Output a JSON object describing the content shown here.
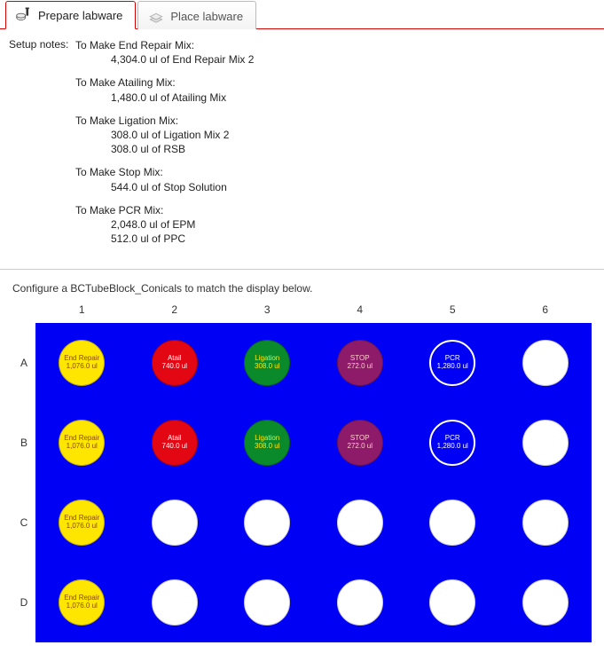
{
  "tabs": [
    {
      "label": "Prepare labware",
      "active": true
    },
    {
      "label": "Place labware",
      "active": false
    }
  ],
  "setup_label": "Setup notes:",
  "recipes": [
    {
      "title": "To Make End Repair Mix:",
      "lines": [
        "4,304.0 ul of End Repair Mix 2"
      ]
    },
    {
      "title": "To Make Atailing Mix:",
      "lines": [
        "1,480.0 ul of Atailing Mix"
      ]
    },
    {
      "title": "To Make Ligation Mix:",
      "lines": [
        "308.0 ul of Ligation Mix 2",
        "308.0 ul of RSB"
      ]
    },
    {
      "title": "To Make Stop Mix:",
      "lines": [
        "544.0 ul of Stop Solution"
      ]
    },
    {
      "title": "To Make PCR Mix:",
      "lines": [
        "2,048.0 ul of EPM",
        "512.0 ul of PPC"
      ]
    }
  ],
  "configure_text": "Configure a BCTubeBlock_Conicals to match the display below.",
  "columns": [
    "1",
    "2",
    "3",
    "4",
    "5",
    "6"
  ],
  "rows": [
    "A",
    "B",
    "C",
    "D"
  ],
  "wells": {
    "A": [
      {
        "name": "End Repair",
        "vol": "1,076.0 ul",
        "color": "yellow"
      },
      {
        "name": "Atail",
        "vol": "740.0 ul",
        "color": "red"
      },
      {
        "name": "Ligation",
        "vol": "308.0 ul",
        "color": "green"
      },
      {
        "name": "STOP",
        "vol": "272.0 ul",
        "color": "purple"
      },
      {
        "name": "PCR",
        "vol": "1,280.0 ul",
        "color": "outline"
      },
      {
        "name": "",
        "vol": "",
        "color": "white"
      }
    ],
    "B": [
      {
        "name": "End Repair",
        "vol": "1,076.0 ul",
        "color": "yellow"
      },
      {
        "name": "Atail",
        "vol": "740.0 ul",
        "color": "red"
      },
      {
        "name": "Ligation",
        "vol": "308.0 ul",
        "color": "green"
      },
      {
        "name": "STOP",
        "vol": "272.0 ul",
        "color": "purple"
      },
      {
        "name": "PCR",
        "vol": "1,280.0 ul",
        "color": "outline"
      },
      {
        "name": "",
        "vol": "",
        "color": "white"
      }
    ],
    "C": [
      {
        "name": "End Repair",
        "vol": "1,076.0 ul",
        "color": "yellow"
      },
      {
        "name": "",
        "vol": "",
        "color": "white"
      },
      {
        "name": "",
        "vol": "",
        "color": "white"
      },
      {
        "name": "",
        "vol": "",
        "color": "white"
      },
      {
        "name": "",
        "vol": "",
        "color": "white"
      },
      {
        "name": "",
        "vol": "",
        "color": "white"
      }
    ],
    "D": [
      {
        "name": "End Repair",
        "vol": "1,076.0 ul",
        "color": "yellow"
      },
      {
        "name": "",
        "vol": "",
        "color": "white"
      },
      {
        "name": "",
        "vol": "",
        "color": "white"
      },
      {
        "name": "",
        "vol": "",
        "color": "white"
      },
      {
        "name": "",
        "vol": "",
        "color": "white"
      },
      {
        "name": "",
        "vol": "",
        "color": "white"
      }
    ]
  }
}
